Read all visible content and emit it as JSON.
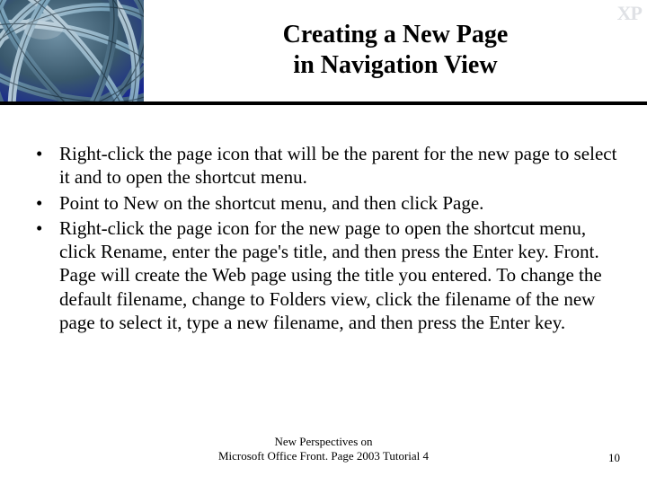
{
  "header": {
    "title_line1": "Creating a New Page",
    "title_line2": "in Navigation View",
    "corner_mark": "XP"
  },
  "bullets": [
    "Right-click the page icon that will be the parent for the new page to select it and to open the shortcut menu.",
    "Point to New on the shortcut menu, and then click Page.",
    "Right-click the page icon for the new page to open the shortcut menu, click Rename, enter the page's title, and then press the Enter key. Front. Page will create the Web page using the title you entered. To change the default filename, change to Folders view, click the filename of the new page to select it, type a new filename, and then press the Enter key."
  ],
  "footer": {
    "line1": "New Perspectives on",
    "line2": "Microsoft Office Front. Page 2003 Tutorial 4",
    "page_number": "10"
  }
}
